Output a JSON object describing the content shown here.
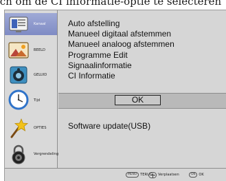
{
  "caption": "tsch om de CI informatie-optie te selecteren",
  "sidebar": {
    "items": [
      {
        "label": "Kanaal",
        "icon": "channel-screen-icon",
        "active": true
      },
      {
        "label": "BEELD",
        "icon": "picture-icon",
        "active": false
      },
      {
        "label": "GELUID",
        "icon": "speaker-icon",
        "active": false
      },
      {
        "label": "Tijd",
        "icon": "clock-icon",
        "active": false
      },
      {
        "label": "OPTIES",
        "icon": "star-wand-icon",
        "active": false
      },
      {
        "label": "Vergrendeling",
        "icon": "padlock-icon",
        "active": false
      }
    ]
  },
  "menu": {
    "items": [
      "Auto afstelling",
      "Manueel digitaal afstemmen",
      "Manueel analoog afstemmen",
      "Programme Edit",
      "Signaalinformatie",
      "CI Informatie"
    ],
    "selected": "OK",
    "extra_item": "Software update(USB)"
  },
  "footer": {
    "menu_key": "MENU",
    "back_label": "TERUG",
    "move_label": "Verplaatsen",
    "ok_key": "OK",
    "ok_label": "OK"
  },
  "colors": {
    "background": "#d6d6d6",
    "selected_band": "#b9b9b9",
    "active_sidebar": "#8c97cc"
  }
}
